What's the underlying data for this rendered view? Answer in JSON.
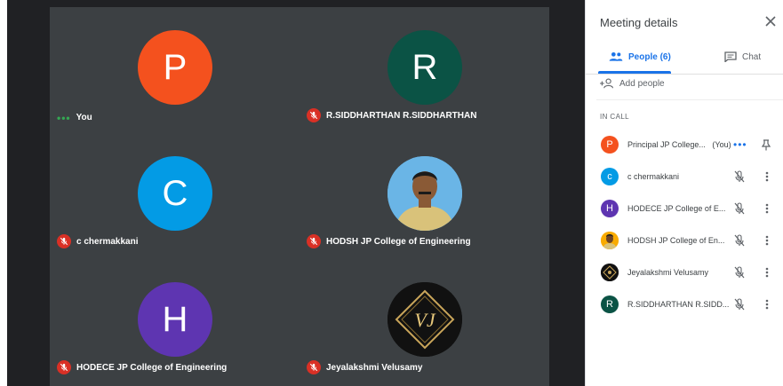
{
  "panel": {
    "title": "Meeting details",
    "tabs": {
      "people_label": "People (6)",
      "chat_label": "Chat"
    },
    "add_people_label": "Add people",
    "section_label": "IN CALL",
    "participants": [
      {
        "initial": "P",
        "name": "Principal JP College...",
        "you_tag": "(You)",
        "color": "#f4511e"
      },
      {
        "initial": "c",
        "name": "c chermakkani",
        "color": "#039be5"
      },
      {
        "initial": "H",
        "name": "HODECE JP College of E...",
        "color": "#5e35b1"
      },
      {
        "initial": "",
        "name": "HODSH JP College of En...",
        "color": "#f9ab00"
      },
      {
        "initial": "",
        "name": "Jeyalakshmi Velusamy",
        "color": "#111111"
      },
      {
        "initial": "R",
        "name": "R.SIDDHARTHAN R.SIDD...",
        "color": "#0b5345"
      }
    ]
  },
  "tiles": [
    {
      "initial": "P",
      "name": "You",
      "color": "#f4511e"
    },
    {
      "initial": "R",
      "name": "R.SIDDHARTHAN R.SIDDHARTHAN",
      "color": "#0b5345"
    },
    {
      "initial": "C",
      "name": "c chermakkani",
      "color": "#039be5"
    },
    {
      "initial": "",
      "name": "HODSH JP College of Engineering",
      "color": "#6ab5e6"
    },
    {
      "initial": "H",
      "name": "HODECE JP College of Engineering",
      "color": "#5e35b1"
    },
    {
      "initial": "VJ",
      "name": "Jeyalakshmi Velusamy",
      "color": "#111111"
    }
  ],
  "colors": {
    "accent": "#1a73e8",
    "muted_red": "#d93025",
    "video_bg": "#202124",
    "tile_bg": "#3c4043"
  }
}
